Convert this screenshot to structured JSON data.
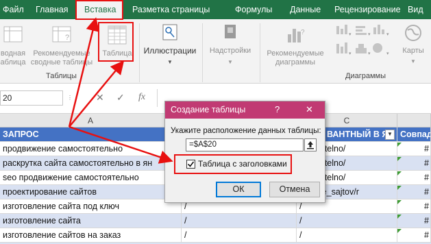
{
  "ribbon_tabs": [
    {
      "label": "Файл"
    },
    {
      "label": "Главная"
    },
    {
      "label": "Вставка"
    },
    {
      "label": "Разметка страницы"
    },
    {
      "label": "Формулы"
    },
    {
      "label": "Данные"
    },
    {
      "label": "Рецензирование"
    },
    {
      "label": "Вид"
    }
  ],
  "ribbon": {
    "pivot": {
      "line1": "водная",
      "line2": "аблица"
    },
    "recommended_pivot": {
      "line1": "Рекомендуемые",
      "line2": "сводные таблицы"
    },
    "table": {
      "label": "Таблица"
    },
    "illustrations": {
      "label": "Иллюстрации"
    },
    "addins": {
      "label": "Надстройки"
    },
    "recommended_charts": {
      "line1": "Рекомендуемые",
      "line2": "диаграммы"
    },
    "maps": {
      "label": "Карты"
    },
    "group_tables": "Таблицы",
    "group_charts": "Диаграммы"
  },
  "formula_bar": {
    "name_box": "20",
    "fx": "fx",
    "cancel": "✕",
    "enter": "✓"
  },
  "grid": {
    "columns": [
      "A",
      "C"
    ],
    "header_row": [
      "ЗАПРОС",
      "ВАНТНЫЙ В Я",
      "Совпад"
    ],
    "rows": [
      {
        "a": "продвижение самостоятельно",
        "c": "ostoyatelno/",
        "d": "#"
      },
      {
        "a": "раскрутка сайта самостоятельно в ян",
        "c": "ostoyatelno/",
        "d": "#"
      },
      {
        "a": "seo продвижение самостоятельно",
        "c": "ostoyatelno/",
        "d": "#"
      },
      {
        "a": "проектирование сайтов",
        "c": "ovlenie_sajtov/r",
        "d": "#"
      },
      {
        "a": "изготовление сайта под ключ",
        "b": "/",
        "c": "/",
        "d": "#"
      },
      {
        "a": "изготовление сайта",
        "b": "/",
        "c": "/",
        "d": "#"
      },
      {
        "a": "изготовление сайтов на заказ",
        "b": "/",
        "c": "/",
        "d": "#"
      }
    ]
  },
  "dialog": {
    "title": "Создание таблицы",
    "help": "?",
    "close": "✕",
    "prompt": "Укажите расположение данных таблицы:",
    "range": "=$A$20",
    "checkbox_label": "Таблица с заголовками",
    "checkbox_checked": true,
    "ok": "ОК",
    "cancel": "Отмена"
  },
  "colors": {
    "ribbon_green": "#217346",
    "dialog_title": "#c13a73",
    "table_header": "#4472c4",
    "band": "#d9e1f2",
    "annotation_red": "#e81010"
  }
}
